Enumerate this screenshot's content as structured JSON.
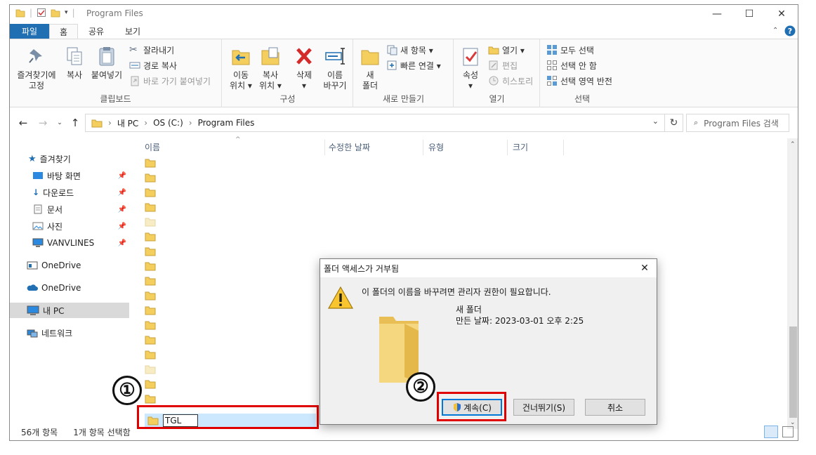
{
  "window": {
    "title": "Program Files",
    "caption": {
      "minimize": "—",
      "maximize": "☐",
      "close": "✕"
    }
  },
  "ribbon": {
    "tabs": [
      "파일",
      "홈",
      "공유",
      "보기"
    ],
    "clipboard": {
      "label": "클립보드",
      "pin_line1": "즐겨찾기에",
      "pin_line2": "고정",
      "copy": "복사",
      "paste": "붙여넣기",
      "cut": "잘라내기",
      "copy_path": "경로 복사",
      "paste_shortcut": "바로 가기 붙여넣기"
    },
    "organize": {
      "label": "구성",
      "move_line1": "이동",
      "move_line2": "위치 ▾",
      "copyto_line1": "복사",
      "copyto_line2": "위치 ▾",
      "delete": "삭제",
      "delete_arrow": "▾",
      "rename_line1": "이름",
      "rename_line2": "바꾸기"
    },
    "new": {
      "label": "새로 만들기",
      "folder_line1": "새",
      "folder_line2": "폴더",
      "new_item": "새 항목 ▾",
      "easy_access": "빠른 연결 ▾"
    },
    "open": {
      "label": "열기",
      "properties": "속성",
      "properties_arrow": "▾",
      "open": "열기 ▾",
      "edit": "편집",
      "history": "히스토리"
    },
    "select": {
      "label": "선택",
      "select_all": "모두 선택",
      "select_none": "선택 안 함",
      "invert": "선택 영역 반전"
    }
  },
  "address": {
    "crumbs": [
      "내 PC",
      "OS (C:)",
      "Program Files"
    ],
    "search_placeholder": "Program Files 검색"
  },
  "navpane": {
    "items": [
      {
        "label": "즐겨찾기",
        "icon": "star-icon"
      },
      {
        "label": "바탕 화면",
        "icon": "desktop-icon",
        "pinned": true
      },
      {
        "label": "다운로드",
        "icon": "download-icon",
        "pinned": true
      },
      {
        "label": "문서",
        "icon": "document-icon",
        "pinned": true
      },
      {
        "label": "사진",
        "icon": "picture-icon",
        "pinned": true
      },
      {
        "label": "VANVLINES",
        "icon": "monitor-icon",
        "pinned": true
      },
      {
        "label": "OneDrive",
        "icon": "onedrive-business-icon"
      },
      {
        "label": "OneDrive",
        "icon": "onedrive-icon"
      },
      {
        "label": "내 PC",
        "icon": "this-pc-icon",
        "selected": true
      },
      {
        "label": "네트워크",
        "icon": "network-icon"
      }
    ]
  },
  "filelist": {
    "columns": [
      "이름",
      "수정한 날짜",
      "유형",
      "크기"
    ],
    "rename_value": "TGL"
  },
  "status": {
    "count": "56개 항목",
    "selected": "1개 항목 선택함"
  },
  "dialog": {
    "title": "폴더 액세스가 거부됨",
    "message": "이 폴더의 이름을 바꾸려면 관리자 권한이 필요합니다.",
    "item_name": "새 폴더",
    "item_date": "만든 날짜: 2023-03-01 오후 2:25",
    "continue": "계속(C)",
    "skip": "건너뛰기(S)",
    "cancel": "취소"
  },
  "annotations": {
    "marker1": "①",
    "marker2": "②"
  },
  "colors": {
    "accent": "#1f6fb2",
    "highlight_box": "#e00000",
    "selection": "#cce8ff",
    "folder": "#f4cf5d"
  }
}
